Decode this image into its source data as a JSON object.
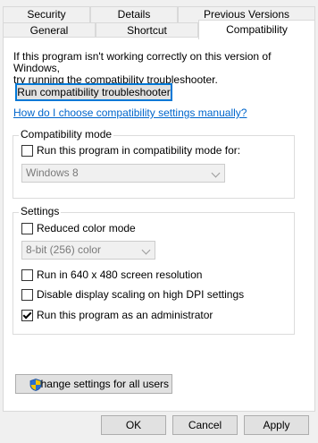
{
  "tabs": {
    "row_back": [
      {
        "label": "Security"
      },
      {
        "label": "Details"
      },
      {
        "label": "Previous Versions"
      }
    ],
    "row_front": [
      {
        "label": "General"
      },
      {
        "label": "Shortcut"
      },
      {
        "label": "Compatibility"
      }
    ],
    "active": "Compatibility"
  },
  "intro_text_line1": "If this program isn't working correctly on this version of Windows,",
  "intro_text_line2": "try running the compatibility troubleshooter.",
  "troubleshooter_button": "Run compatibility troubleshooter",
  "manual_link": "How do I choose compatibility settings manually?",
  "compat_mode": {
    "group_label": "Compatibility mode",
    "checkbox_label": "Run this program in compatibility mode for:",
    "checked": false,
    "selected_os": "Windows 8"
  },
  "settings": {
    "group_label": "Settings",
    "reduced_color": {
      "label": "Reduced color mode",
      "checked": false
    },
    "color_value": "8-bit (256) color",
    "run_640": {
      "label": "Run in 640 x 480 screen resolution",
      "checked": false
    },
    "disable_dpi": {
      "label": "Disable display scaling on high DPI settings",
      "checked": false
    },
    "run_admin": {
      "label": "Run this program as an administrator",
      "checked": true
    }
  },
  "change_all_button": "Change settings for all users",
  "footer": {
    "ok": "OK",
    "cancel": "Cancel",
    "apply": "Apply"
  },
  "colors": {
    "link": "#0066cc",
    "focus_border": "#0078d7",
    "window_bg": "#f0f0f0"
  }
}
